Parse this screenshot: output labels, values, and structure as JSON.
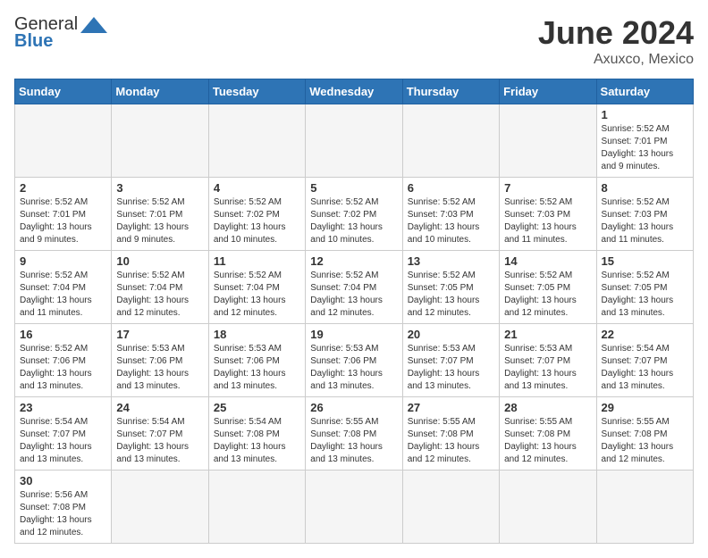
{
  "header": {
    "logo_general": "General",
    "logo_blue": "Blue",
    "title": "June 2024",
    "location": "Axuxco, Mexico"
  },
  "weekdays": [
    "Sunday",
    "Monday",
    "Tuesday",
    "Wednesday",
    "Thursday",
    "Friday",
    "Saturday"
  ],
  "days": [
    {
      "num": "",
      "info": ""
    },
    {
      "num": "",
      "info": ""
    },
    {
      "num": "",
      "info": ""
    },
    {
      "num": "",
      "info": ""
    },
    {
      "num": "",
      "info": ""
    },
    {
      "num": "",
      "info": ""
    },
    {
      "num": "1",
      "info": "Sunrise: 5:52 AM\nSunset: 7:01 PM\nDaylight: 13 hours\nand 9 minutes."
    },
    {
      "num": "2",
      "info": "Sunrise: 5:52 AM\nSunset: 7:01 PM\nDaylight: 13 hours\nand 9 minutes."
    },
    {
      "num": "3",
      "info": "Sunrise: 5:52 AM\nSunset: 7:01 PM\nDaylight: 13 hours\nand 9 minutes."
    },
    {
      "num": "4",
      "info": "Sunrise: 5:52 AM\nSunset: 7:02 PM\nDaylight: 13 hours\nand 10 minutes."
    },
    {
      "num": "5",
      "info": "Sunrise: 5:52 AM\nSunset: 7:02 PM\nDaylight: 13 hours\nand 10 minutes."
    },
    {
      "num": "6",
      "info": "Sunrise: 5:52 AM\nSunset: 7:03 PM\nDaylight: 13 hours\nand 10 minutes."
    },
    {
      "num": "7",
      "info": "Sunrise: 5:52 AM\nSunset: 7:03 PM\nDaylight: 13 hours\nand 11 minutes."
    },
    {
      "num": "8",
      "info": "Sunrise: 5:52 AM\nSunset: 7:03 PM\nDaylight: 13 hours\nand 11 minutes."
    },
    {
      "num": "9",
      "info": "Sunrise: 5:52 AM\nSunset: 7:04 PM\nDaylight: 13 hours\nand 11 minutes."
    },
    {
      "num": "10",
      "info": "Sunrise: 5:52 AM\nSunset: 7:04 PM\nDaylight: 13 hours\nand 12 minutes."
    },
    {
      "num": "11",
      "info": "Sunrise: 5:52 AM\nSunset: 7:04 PM\nDaylight: 13 hours\nand 12 minutes."
    },
    {
      "num": "12",
      "info": "Sunrise: 5:52 AM\nSunset: 7:04 PM\nDaylight: 13 hours\nand 12 minutes."
    },
    {
      "num": "13",
      "info": "Sunrise: 5:52 AM\nSunset: 7:05 PM\nDaylight: 13 hours\nand 12 minutes."
    },
    {
      "num": "14",
      "info": "Sunrise: 5:52 AM\nSunset: 7:05 PM\nDaylight: 13 hours\nand 12 minutes."
    },
    {
      "num": "15",
      "info": "Sunrise: 5:52 AM\nSunset: 7:05 PM\nDaylight: 13 hours\nand 13 minutes."
    },
    {
      "num": "16",
      "info": "Sunrise: 5:52 AM\nSunset: 7:06 PM\nDaylight: 13 hours\nand 13 minutes."
    },
    {
      "num": "17",
      "info": "Sunrise: 5:53 AM\nSunset: 7:06 PM\nDaylight: 13 hours\nand 13 minutes."
    },
    {
      "num": "18",
      "info": "Sunrise: 5:53 AM\nSunset: 7:06 PM\nDaylight: 13 hours\nand 13 minutes."
    },
    {
      "num": "19",
      "info": "Sunrise: 5:53 AM\nSunset: 7:06 PM\nDaylight: 13 hours\nand 13 minutes."
    },
    {
      "num": "20",
      "info": "Sunrise: 5:53 AM\nSunset: 7:07 PM\nDaylight: 13 hours\nand 13 minutes."
    },
    {
      "num": "21",
      "info": "Sunrise: 5:53 AM\nSunset: 7:07 PM\nDaylight: 13 hours\nand 13 minutes."
    },
    {
      "num": "22",
      "info": "Sunrise: 5:54 AM\nSunset: 7:07 PM\nDaylight: 13 hours\nand 13 minutes."
    },
    {
      "num": "23",
      "info": "Sunrise: 5:54 AM\nSunset: 7:07 PM\nDaylight: 13 hours\nand 13 minutes."
    },
    {
      "num": "24",
      "info": "Sunrise: 5:54 AM\nSunset: 7:07 PM\nDaylight: 13 hours\nand 13 minutes."
    },
    {
      "num": "25",
      "info": "Sunrise: 5:54 AM\nSunset: 7:08 PM\nDaylight: 13 hours\nand 13 minutes."
    },
    {
      "num": "26",
      "info": "Sunrise: 5:55 AM\nSunset: 7:08 PM\nDaylight: 13 hours\nand 13 minutes."
    },
    {
      "num": "27",
      "info": "Sunrise: 5:55 AM\nSunset: 7:08 PM\nDaylight: 13 hours\nand 12 minutes."
    },
    {
      "num": "28",
      "info": "Sunrise: 5:55 AM\nSunset: 7:08 PM\nDaylight: 13 hours\nand 12 minutes."
    },
    {
      "num": "29",
      "info": "Sunrise: 5:55 AM\nSunset: 7:08 PM\nDaylight: 13 hours\nand 12 minutes."
    },
    {
      "num": "30",
      "info": "Sunrise: 5:56 AM\nSunset: 7:08 PM\nDaylight: 13 hours\nand 12 minutes."
    },
    {
      "num": "",
      "info": ""
    },
    {
      "num": "",
      "info": ""
    },
    {
      "num": "",
      "info": ""
    },
    {
      "num": "",
      "info": ""
    },
    {
      "num": "",
      "info": ""
    },
    {
      "num": "",
      "info": ""
    }
  ]
}
